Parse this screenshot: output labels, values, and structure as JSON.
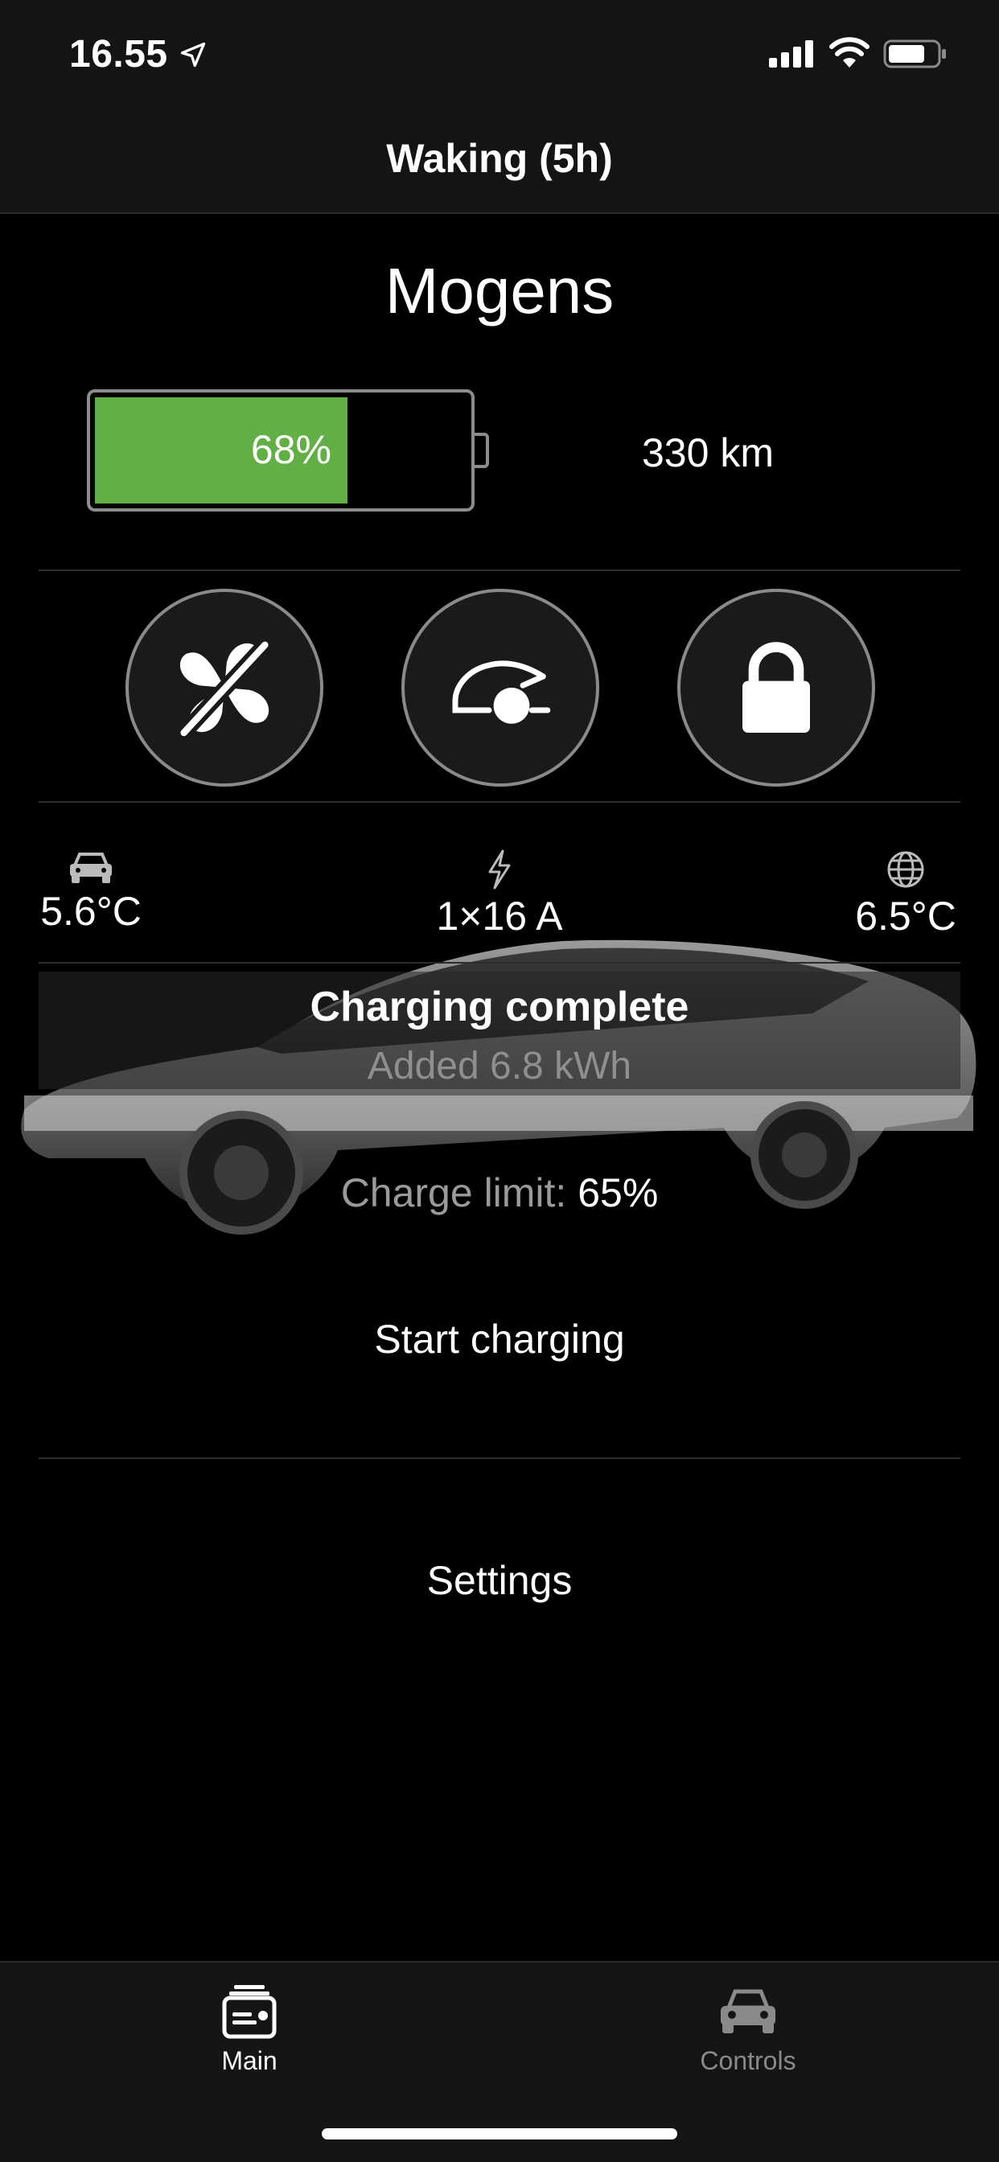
{
  "status_bar": {
    "time": "16.55"
  },
  "nav": {
    "title": "Waking (5h)"
  },
  "vehicle": {
    "name": "Mogens"
  },
  "battery": {
    "level_percent": 68,
    "label": "68%",
    "range": "330 km",
    "fill_color": "#62b045"
  },
  "controls": [
    {
      "name": "climate",
      "icon": "fan-off-icon"
    },
    {
      "name": "frunk",
      "icon": "car-trunk-icon"
    },
    {
      "name": "lock",
      "icon": "lock-icon"
    }
  ],
  "stats": {
    "inside_temp": {
      "icon": "car-icon",
      "value": "5.6°C"
    },
    "charger": {
      "icon": "bolt-icon",
      "value": "1×16 A"
    },
    "outside_temp": {
      "icon": "globe-icon",
      "value": "6.5°C"
    }
  },
  "charging": {
    "status": "Charging complete",
    "added": "Added 6.8 kWh",
    "limit_label": "Charge limit:",
    "limit_value": "65%"
  },
  "actions": {
    "start_charging": "Start charging",
    "settings": "Settings"
  },
  "tabs": [
    {
      "label": "Main",
      "active": true,
      "icon": "main-tab-icon"
    },
    {
      "label": "Controls",
      "active": false,
      "icon": "car-icon"
    }
  ]
}
